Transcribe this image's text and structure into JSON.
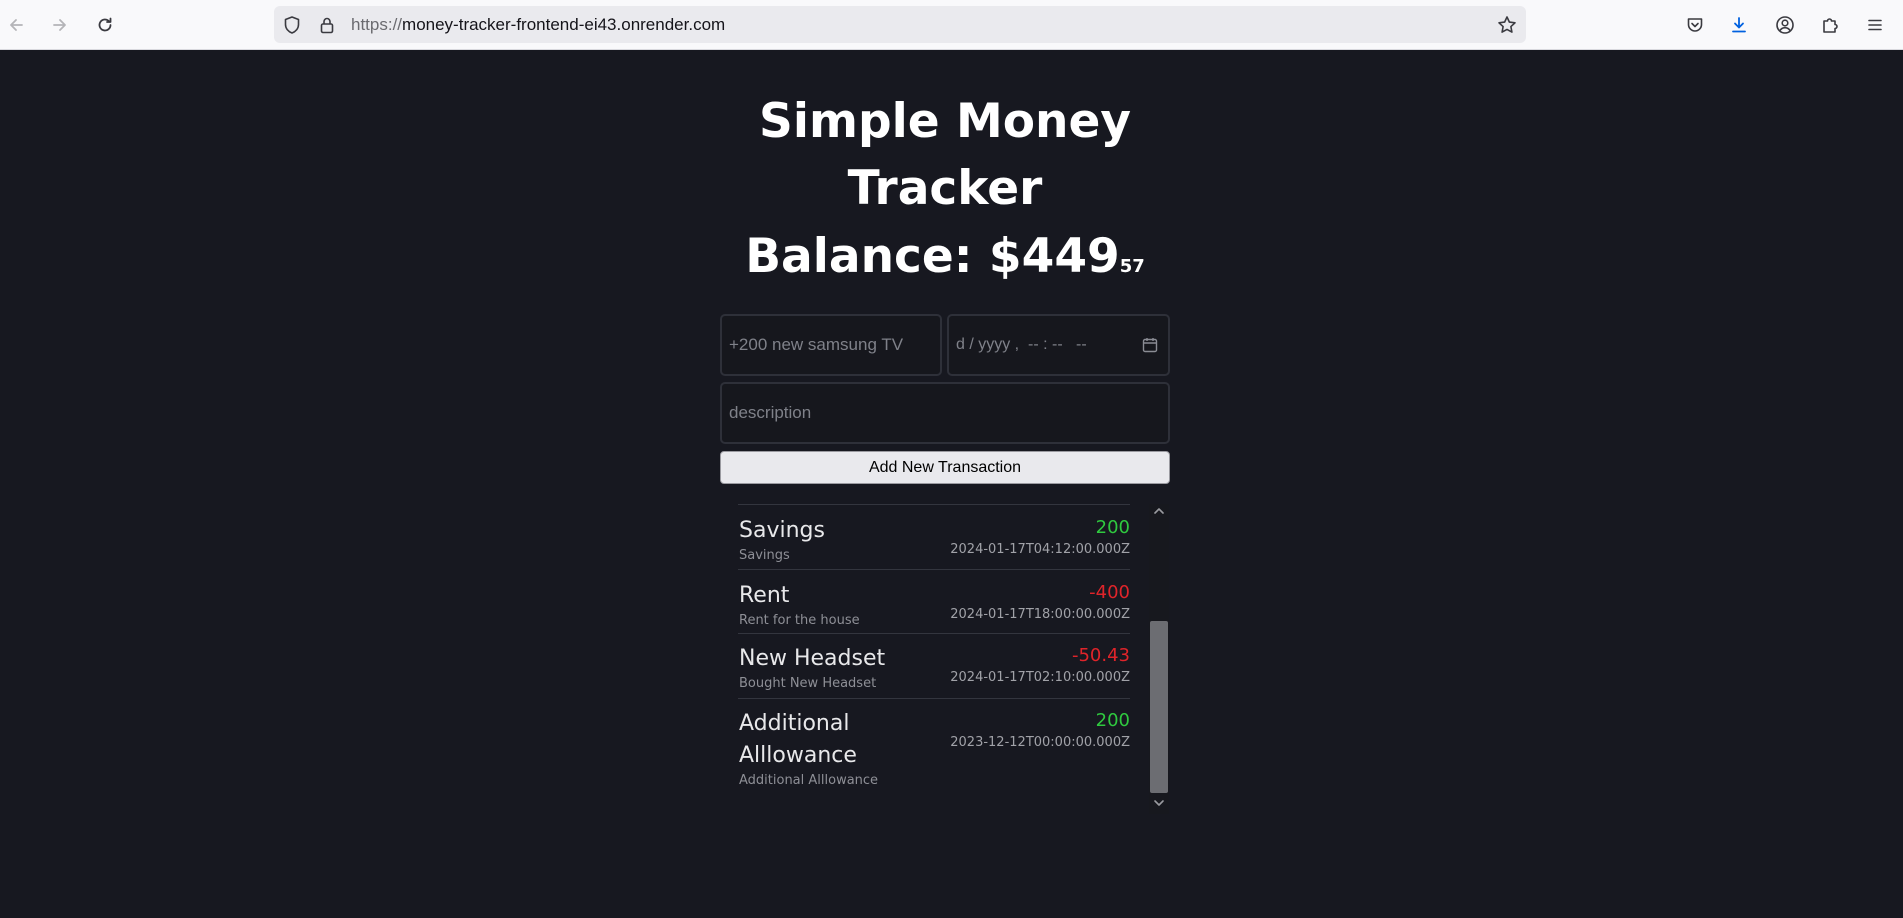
{
  "browser": {
    "url_protocol": "https://",
    "url_host": "money-tracker-frontend-ei43.onrender.com",
    "icons": {
      "back": "arrow-left-icon",
      "forward": "arrow-right-icon",
      "reload": "reload-icon",
      "tracking_protection": "shield-icon",
      "lock": "lock-icon",
      "bookmark": "star-icon",
      "pocket": "pocket-icon",
      "downloads": "download-icon",
      "account": "account-icon",
      "extensions": "puzzle-icon",
      "menu": "hamburger-menu-icon"
    }
  },
  "page": {
    "title": "Simple Money Tracker",
    "balance_label": "Balance: $449",
    "balance_cents": "57"
  },
  "form": {
    "name_placeholder": "+200 new samsung TV",
    "datetime_placeholder": "d / yyyy ,  -- : --   --",
    "description_placeholder": "description",
    "submit_label": "Add New Transaction"
  },
  "transactions": [
    {
      "name": "Savings",
      "description": "Savings",
      "amount": "200",
      "datetime": "2024-01-17T04:12:00.000Z",
      "type": "positive"
    },
    {
      "name": "Rent",
      "description": "Rent for the house",
      "amount": "-400",
      "datetime": "2024-01-17T18:00:00.000Z",
      "type": "negative"
    },
    {
      "name": "New Headset",
      "description": "Bought New Headset",
      "amount": "-50.43",
      "datetime": "2024-01-17T02:10:00.000Z",
      "type": "negative"
    },
    {
      "name": "Additional Alllowance",
      "description": "Additional Alllowance",
      "amount": "200",
      "datetime": "2023-12-12T00:00:00.000Z",
      "type": "positive"
    }
  ],
  "colors": {
    "background": "#171820",
    "positive": "#2fc93f",
    "negative": "#e0242a"
  }
}
